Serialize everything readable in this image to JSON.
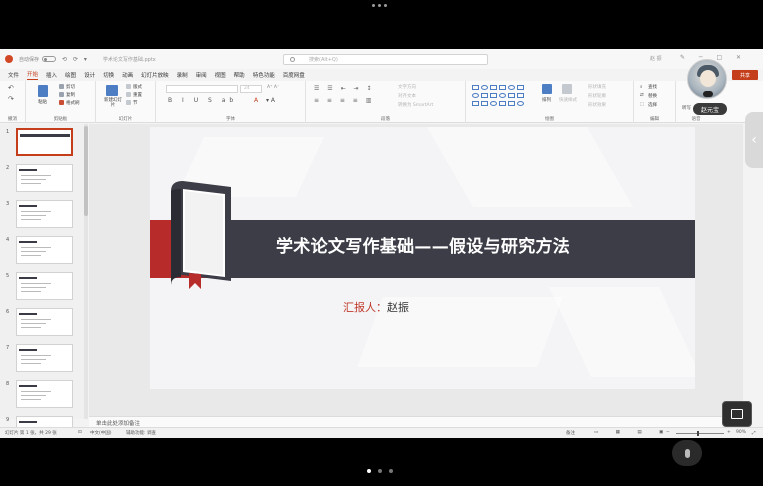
{
  "titlebar": {
    "autosave": "自动保存",
    "file_name": "学术论文写作基础.pptx",
    "search_placeholder": "搜索(Alt+Q)",
    "user": "赵 振"
  },
  "tabs": [
    "文件",
    "开始",
    "插入",
    "绘图",
    "设计",
    "切换",
    "动画",
    "幻灯片放映",
    "录制",
    "审阅",
    "视图",
    "帮助",
    "特色功能",
    "百度网盘"
  ],
  "active_tab_index": 1,
  "share_label": "共享",
  "ribbon": {
    "groups": [
      "撤消",
      "剪贴板",
      "幻灯片",
      "字体",
      "段落",
      "绘图",
      "编辑",
      "语音"
    ],
    "clipboard": {
      "paste": "粘贴",
      "cut": "剪切",
      "copy": "复制",
      "format_painter": "格式刷"
    },
    "slides": {
      "new_slide": "新建幻灯片",
      "layout": "版式",
      "reset": "重置",
      "section": "节"
    },
    "font_size": "24",
    "paragraph": {
      "text_direction": "文字方向",
      "align_text": "对齐文本",
      "smartart": "转换为 SmartArt"
    },
    "drawing": {
      "arrange": "排列",
      "quick_styles": "快速样式",
      "shape_fill": "形状填充",
      "shape_outline": "形状轮廓",
      "shape_effects": "形状效果"
    },
    "editing": {
      "find": "查找",
      "replace": "替换",
      "select": "选择"
    },
    "voice": {
      "dictate": "听写"
    }
  },
  "thumbnails": [
    {
      "num": "1",
      "selected": true
    },
    {
      "num": "2",
      "selected": false
    },
    {
      "num": "3",
      "selected": false
    },
    {
      "num": "4",
      "selected": false
    },
    {
      "num": "5",
      "selected": false
    },
    {
      "num": "6",
      "selected": false
    },
    {
      "num": "7",
      "selected": false
    },
    {
      "num": "8",
      "selected": false
    },
    {
      "num": "9",
      "selected": false
    }
  ],
  "slide": {
    "title": "学术论文写作基础——假设与研究方法",
    "presenter_label": "汇报人：",
    "presenter_name": "赵振"
  },
  "notes_placeholder": "单击此处添加备注",
  "status": {
    "slide_counter": "幻灯片 第 1 张，共 29 张",
    "language": "中文(中国)",
    "accessibility": "辅助功能: 调查",
    "notes": "备注",
    "zoom": "90%"
  },
  "participant": {
    "name": "赵元宝"
  },
  "colors": {
    "accent": "#c43e1c",
    "banner": "#3d3d48",
    "banner_red": "#b72b2b"
  }
}
